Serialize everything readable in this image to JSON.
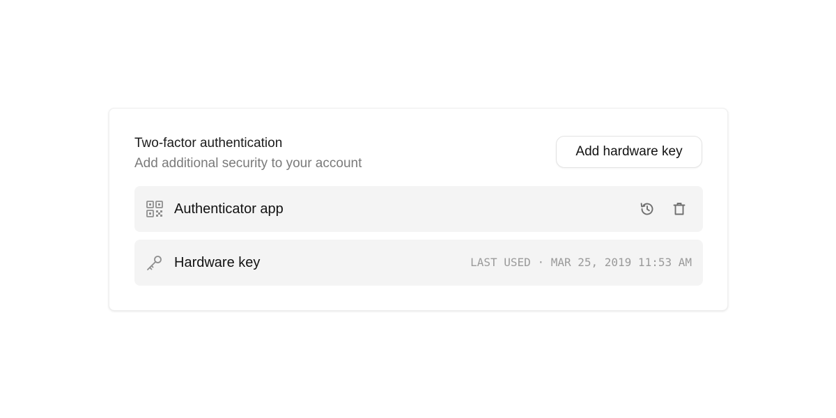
{
  "section": {
    "title": "Two-factor authentication",
    "subtitle": "Add additional security to your account",
    "add_button_label": "Add hardware key"
  },
  "methods": [
    {
      "label": "Authenticator app",
      "icon": "qr-code-icon",
      "actions": [
        "history-icon",
        "trash-icon"
      ]
    },
    {
      "label": "Hardware key",
      "icon": "key-icon",
      "last_used": "LAST USED · MAR 25, 2019 11:53 AM"
    }
  ],
  "colors": {
    "row_background": "#f4f4f4",
    "muted_text": "#7a7a7a",
    "meta_text": "#9a9a9a",
    "icon_gray": "#8e8e8e"
  }
}
